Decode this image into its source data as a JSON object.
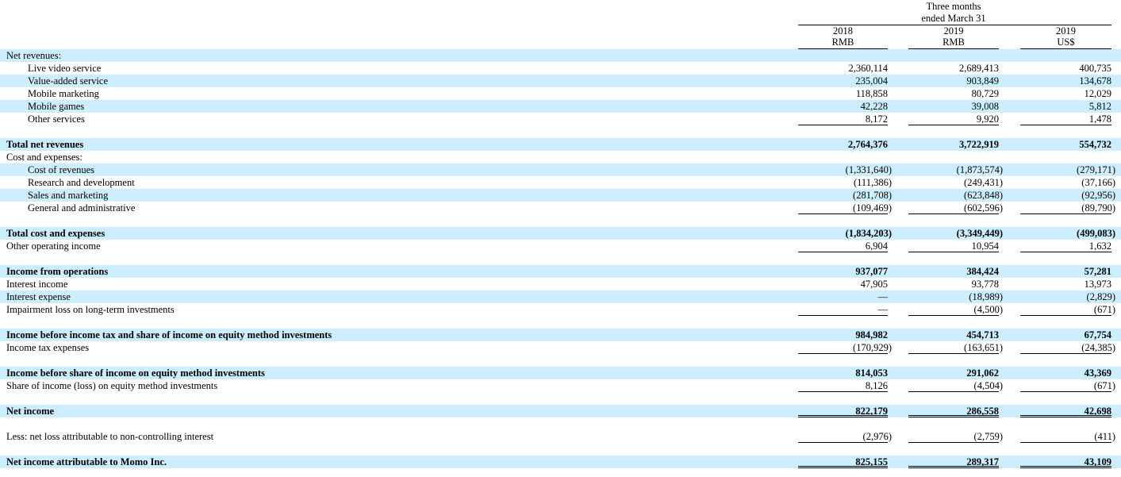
{
  "header": {
    "period_line1": "Three months",
    "period_line2": "ended March 31",
    "columns": [
      {
        "year": "2018",
        "currency": "RMB"
      },
      {
        "year": "2019",
        "currency": "RMB"
      },
      {
        "year": "2019",
        "currency": "US$"
      }
    ]
  },
  "colors": {
    "row_shade": "#cceeff"
  },
  "rows": [
    {
      "label": "Net revenues:",
      "values": [
        "",
        "",
        ""
      ],
      "shaded": true
    },
    {
      "label": "Live video service",
      "values": [
        "2,360,114",
        "2,689,413",
        "400,735"
      ],
      "indent": true
    },
    {
      "label": "Value-added service",
      "values": [
        "235,004",
        "903,849",
        "134,678"
      ],
      "indent": true,
      "shaded": true
    },
    {
      "label": "Mobile marketing",
      "values": [
        "118,858",
        "80,729",
        "12,029"
      ],
      "indent": true
    },
    {
      "label": "Mobile games",
      "values": [
        "42,228",
        "39,008",
        "5,812"
      ],
      "indent": true,
      "shaded": true
    },
    {
      "label": "Other services",
      "values": [
        "8,172",
        "9,920",
        "1,478"
      ],
      "indent": true,
      "rule": "single"
    },
    {
      "blank": true
    },
    {
      "label": "Total net revenues",
      "values": [
        "2,764,376",
        "3,722,919",
        "554,732"
      ],
      "bold": true,
      "shaded": true
    },
    {
      "label": "Cost and expenses:",
      "values": [
        "",
        "",
        ""
      ]
    },
    {
      "label": "Cost of revenues",
      "values": [
        "(1,331,640)",
        "(1,873,574)",
        "(279,171)"
      ],
      "indent": true,
      "shaded": true
    },
    {
      "label": "Research and development",
      "values": [
        "(111,386)",
        "(249,431)",
        "(37,166)"
      ],
      "indent": true
    },
    {
      "label": "Sales and marketing",
      "values": [
        "(281,708)",
        "(623,848)",
        "(92,956)"
      ],
      "indent": true,
      "shaded": true
    },
    {
      "label": "General and administrative",
      "values": [
        "(109,469)",
        "(602,596)",
        "(89,790)"
      ],
      "indent": true,
      "rule": "single"
    },
    {
      "blank": true
    },
    {
      "label": "Total cost and expenses",
      "values": [
        "(1,834,203)",
        "(3,349,449)",
        "(499,083)"
      ],
      "bold": true,
      "shaded": true
    },
    {
      "label": "Other operating income",
      "values": [
        "6,904",
        "10,954",
        "1,632"
      ],
      "rule": "single"
    },
    {
      "blank": true
    },
    {
      "label": "Income from operations",
      "values": [
        "937,077",
        "384,424",
        "57,281"
      ],
      "bold": true,
      "shaded": true
    },
    {
      "label": "Interest income",
      "values": [
        "47,905",
        "93,778",
        "13,973"
      ]
    },
    {
      "label": "Interest expense",
      "values": [
        "—",
        "(18,989)",
        "(2,829)"
      ],
      "shaded": true
    },
    {
      "label": "Impairment loss on long-term investments",
      "values": [
        "—",
        "(4,500)",
        "(671)"
      ],
      "rule": "single"
    },
    {
      "blank": true
    },
    {
      "label": "Income before income tax and share of income on equity method investments",
      "values": [
        "984,982",
        "454,713",
        "67,754"
      ],
      "bold": true,
      "shaded": true
    },
    {
      "label": "Income tax expenses",
      "values": [
        "(170,929)",
        "(163,651)",
        "(24,385)"
      ],
      "rule": "single"
    },
    {
      "blank": true
    },
    {
      "label": "Income before share of income on equity method investments",
      "values": [
        "814,053",
        "291,062",
        "43,369"
      ],
      "bold": true,
      "shaded": true
    },
    {
      "label": "Share of income (loss) on equity method investments",
      "values": [
        "8,126",
        "(4,504)",
        "(671)"
      ],
      "rule": "single"
    },
    {
      "blank": true
    },
    {
      "label": "Net income",
      "values": [
        "822,179",
        "286,558",
        "42,698"
      ],
      "bold": true,
      "shaded": true,
      "rule": "double"
    },
    {
      "blank": true
    },
    {
      "label": "Less: net loss attributable to non-controlling interest",
      "values": [
        "(2,976)",
        "(2,759)",
        "(411)"
      ],
      "rule": "single"
    },
    {
      "blank": true
    },
    {
      "label": "Net income attributable to Momo Inc.",
      "values": [
        "825,155",
        "289,317",
        "43,109"
      ],
      "bold": true,
      "shaded": true,
      "rule": "double"
    }
  ]
}
